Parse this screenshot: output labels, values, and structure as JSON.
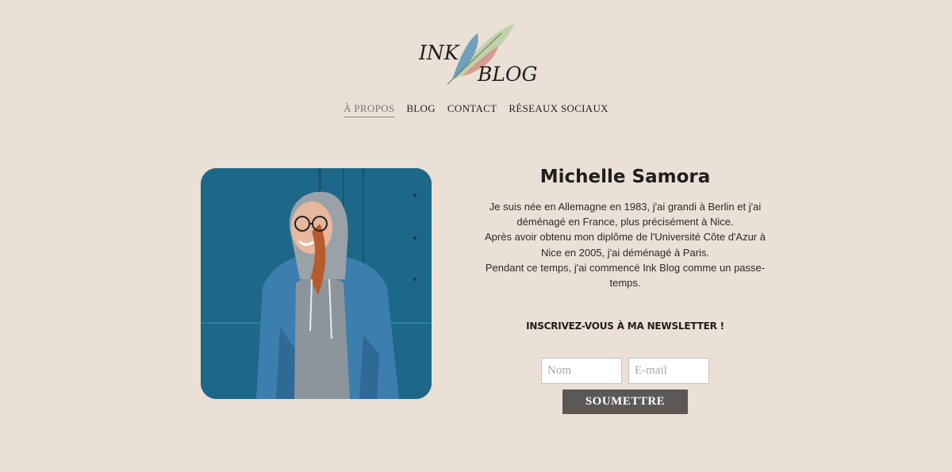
{
  "brand": {
    "line1": "INK",
    "line2": "BLOG"
  },
  "nav": {
    "items": [
      {
        "label": "À PROPOS",
        "active": true
      },
      {
        "label": "BLOG",
        "active": false
      },
      {
        "label": "CONTACT",
        "active": false
      },
      {
        "label": "RÉSEAUX SOCIAUX",
        "active": false
      }
    ]
  },
  "profile": {
    "name": "Michelle Samora",
    "bio": [
      "Je suis née en Allemagne en 1983, j'ai grandi à Berlin et j'ai déménagé en France, plus précisément à Nice.",
      "Après avoir obtenu mon diplôme de l'Université Côte d'Azur à Nice en 2005, j'ai déménagé à Paris.",
      "Pendant ce temps, j'ai commencé Ink Blog comme un passe-temps."
    ]
  },
  "newsletter": {
    "heading": "INSCRIVEZ-VOUS À MA NEWSLETTER !",
    "name_placeholder": "Nom",
    "email_placeholder": "E-mail",
    "submit_label": "SOUMETTRE"
  },
  "colors": {
    "background": "#ebe0d5",
    "button": "#5b5855",
    "photo_wall": "#1f6e8f"
  }
}
